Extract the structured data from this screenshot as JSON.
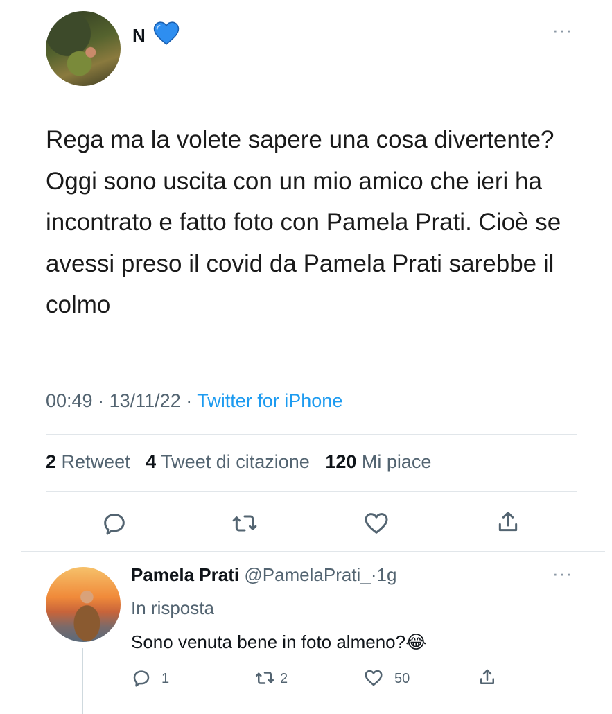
{
  "tweet": {
    "author_name": "N",
    "author_badge_icon": "blue-heart-icon",
    "text": "Rega ma la volete sapere una cosa divertente? Oggi sono uscita con un mio amico che ieri ha incontrato e fatto foto con Pamela Prati. Cioè se avessi preso il covid da Pamela Prati sarebbe il colmo",
    "time": "00:49",
    "date": "13/11/22",
    "source": "Twitter for iPhone",
    "separator": "·",
    "stats": {
      "retweets_count": "2",
      "retweets_label": "Retweet",
      "quotes_count": "4",
      "quotes_label": "Tweet di citazione",
      "likes_count": "120",
      "likes_label": "Mi piace"
    }
  },
  "reply": {
    "author_name": "Pamela Prati",
    "handle": "@PamelaPrati_",
    "age": "1g",
    "in_reply_to": "In risposta",
    "text": "Sono venuta bene in foto almeno?",
    "emoji": "😂",
    "reply_count": "1",
    "retweet_count": "2",
    "like_count": "50"
  },
  "colors": {
    "link": "#1d9bf0",
    "muted": "#536471",
    "text": "#0f1419"
  }
}
